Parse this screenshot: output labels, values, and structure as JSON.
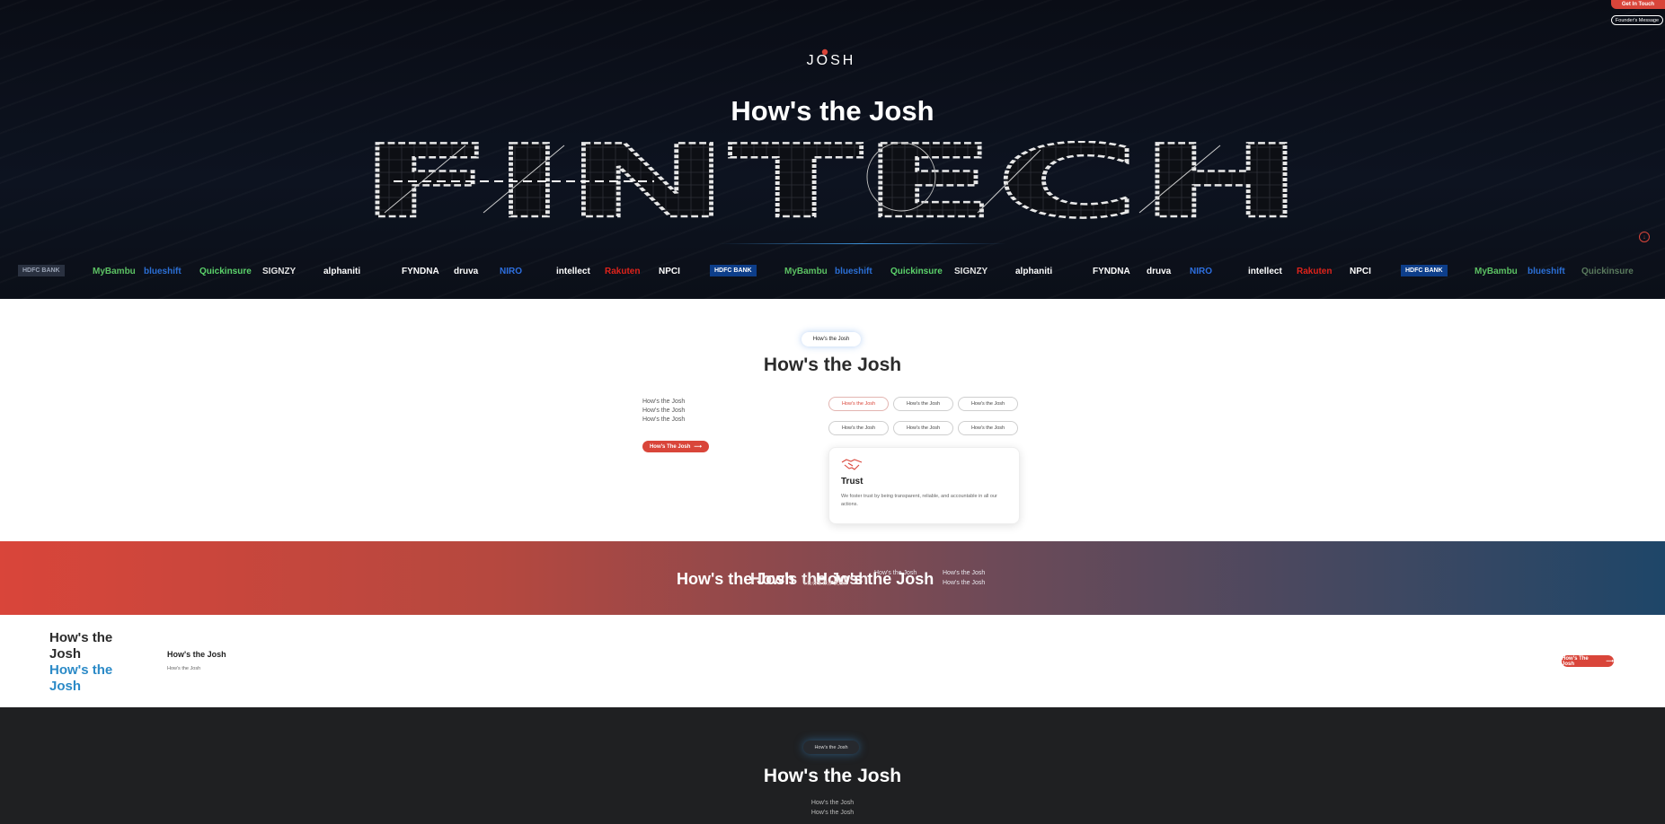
{
  "header": {
    "get_in_touch": "Get In Touch",
    "founders_message": "Founder's Message",
    "logo_text": "JOSH"
  },
  "hero": {
    "title": "How's the Josh",
    "big_word": "FINTECH",
    "scroll_icon": "arrow-down-circle-icon"
  },
  "partners": [
    {
      "name": "HDFC BANK",
      "color": "#9aa3b5"
    },
    {
      "name": "MyBambu",
      "color": "#5cc163"
    },
    {
      "name": "blueshift",
      "color": "#2b6fd6"
    },
    {
      "name": "Quickinsure",
      "color": "#5cd36b"
    },
    {
      "name": "SIGNZY",
      "color": "#e4e4e4"
    },
    {
      "name": "alphaniti",
      "color": "#ffffff"
    },
    {
      "name": "FYNDNA",
      "color": "#ffffff"
    },
    {
      "name": "druva",
      "color": "#ffffff"
    },
    {
      "name": "NIRO",
      "color": "#2d6fe0"
    },
    {
      "name": "intellect",
      "color": "#ffffff"
    },
    {
      "name": "Rakuten",
      "color": "#e0231b"
    },
    {
      "name": "NPCI",
      "color": "#ffffff"
    },
    {
      "name": "HDFC BANK",
      "color": "#ffffff"
    },
    {
      "name": "MyBambu",
      "color": "#5cc163"
    },
    {
      "name": "blueshift",
      "color": "#2b6fd6"
    },
    {
      "name": "Quickinsure",
      "color": "#5cd36b"
    },
    {
      "name": "SIGNZY",
      "color": "#e4e4e4"
    },
    {
      "name": "alphaniti",
      "color": "#ffffff"
    },
    {
      "name": "FYNDNA",
      "color": "#ffffff"
    },
    {
      "name": "druva",
      "color": "#ffffff"
    },
    {
      "name": "NIRO",
      "color": "#2d6fe0"
    },
    {
      "name": "intellect",
      "color": "#ffffff"
    },
    {
      "name": "Rakuten",
      "color": "#e0231b"
    },
    {
      "name": "NPCI",
      "color": "#ffffff"
    },
    {
      "name": "HDFC BANK",
      "color": "#ffffff"
    },
    {
      "name": "MyBambu",
      "color": "#5cc163"
    },
    {
      "name": "blueshift",
      "color": "#2b6fd6"
    },
    {
      "name": "Quickinsure",
      "color": "#5a7a5d"
    }
  ],
  "values": {
    "pill": "How's the Josh",
    "title": "How's the Josh",
    "desc": [
      "How's the Josh",
      "How's the Josh",
      "How's the Josh"
    ],
    "cta": "How's The Josh",
    "tabs": [
      "How's the Josh",
      "How's the Josh",
      "How's the Josh",
      "How's the Josh",
      "How's the Josh",
      "How's the Josh"
    ],
    "card": {
      "icon": "handshake-icon",
      "title": "Trust",
      "text": "We foster trust by being transparent, reliable, and accountable in all our actions."
    }
  },
  "band": {
    "titles": [
      "How's the Josh",
      "How's the Josh",
      "How's the Josh"
    ],
    "subs_center": [
      "How's the Josh",
      "How's the Josh"
    ],
    "subs_right": [
      "How's the Josh",
      "How's the Josh"
    ]
  },
  "career": {
    "heading_dark": "How's the Josh",
    "heading_blue": "How's the Josh",
    "title": "How's the Josh",
    "subtitle": "How's the Josh",
    "cta": "How's The Josh"
  },
  "dark": {
    "pill": "How's the Josh",
    "title": "How's the Josh",
    "subs": [
      "How's the Josh",
      "How's the Josh"
    ]
  },
  "colors": {
    "accent_red": "#d9453a",
    "accent_blue": "#2b8ac7",
    "hero_bg": "#0b0f18",
    "dark_bg": "#1f2022"
  }
}
